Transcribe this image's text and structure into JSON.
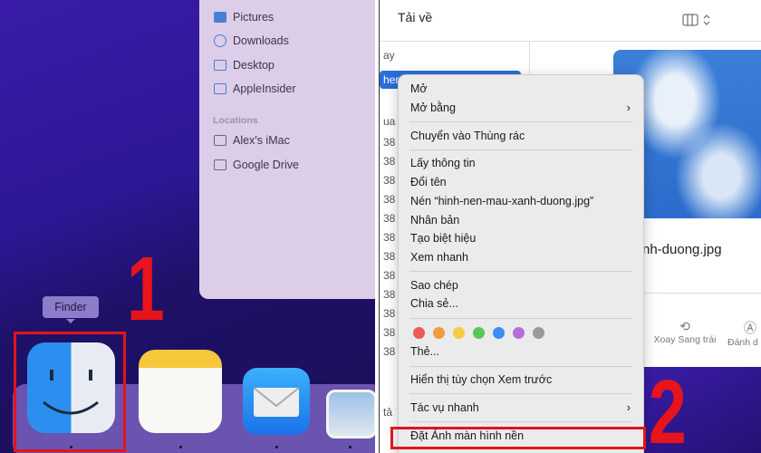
{
  "left_panel": {
    "sidebar": {
      "favorites": [
        {
          "label": "Pictures",
          "icon": "pictures-icon"
        },
        {
          "label": "Downloads",
          "icon": "downloads-icon"
        },
        {
          "label": "Desktop",
          "icon": "desktop-icon"
        },
        {
          "label": "AppleInsider",
          "icon": "folder-icon"
        }
      ],
      "locations_header": "Locations",
      "locations": [
        {
          "label": "Alex's iMac",
          "icon": "imac-icon"
        },
        {
          "label": "Google Drive",
          "icon": "folder-icon"
        }
      ]
    },
    "tooltip": "Finder",
    "step_number": "1",
    "dock_apps": [
      "Finder",
      "Notes",
      "Mail",
      "Preview"
    ]
  },
  "right_panel": {
    "title": "Tải về",
    "list_fragments": [
      "ay",
      "hen",
      "ua",
      "38",
      "38",
      "38",
      "38",
      "38",
      "38",
      "38",
      "38",
      "38",
      "38",
      "38",
      "38",
      "tả"
    ],
    "file_name_fragment": "nh-duong.jpg",
    "toolbar": {
      "rotate_left": "Xoay Sang trái",
      "markup": "Đánh d"
    },
    "context_menu": {
      "groups": [
        [
          {
            "label": "Mở"
          },
          {
            "label": "Mở bằng",
            "submenu": true
          }
        ],
        [
          {
            "label": "Chuyển vào Thùng rác"
          }
        ],
        [
          {
            "label": "Lấy thông tin"
          },
          {
            "label": "Đổi tên"
          },
          {
            "label": "Nén “hinh-nen-mau-xanh-duong.jpg”"
          },
          {
            "label": "Nhân bản"
          },
          {
            "label": "Tạo biệt hiệu"
          },
          {
            "label": "Xem nhanh"
          }
        ],
        [
          {
            "label": "Sao chép"
          },
          {
            "label": "Chia sẻ..."
          }
        ]
      ],
      "tag_colors": [
        "#ec5a56",
        "#f29a3e",
        "#f6cb45",
        "#5ac558",
        "#3d8ef0",
        "#b66fd8",
        "#9a9a9a"
      ],
      "tags_label": "Thẻ...",
      "preview_options": "Hiển thị tùy chọn Xem trước",
      "quick_actions": "Tác vụ nhanh",
      "set_wallpaper": "Đặt Ảnh màn hình nền"
    },
    "step_number": "2"
  },
  "colors": {
    "highlight": "#e2141b",
    "wallpaper": "#2d1795"
  }
}
